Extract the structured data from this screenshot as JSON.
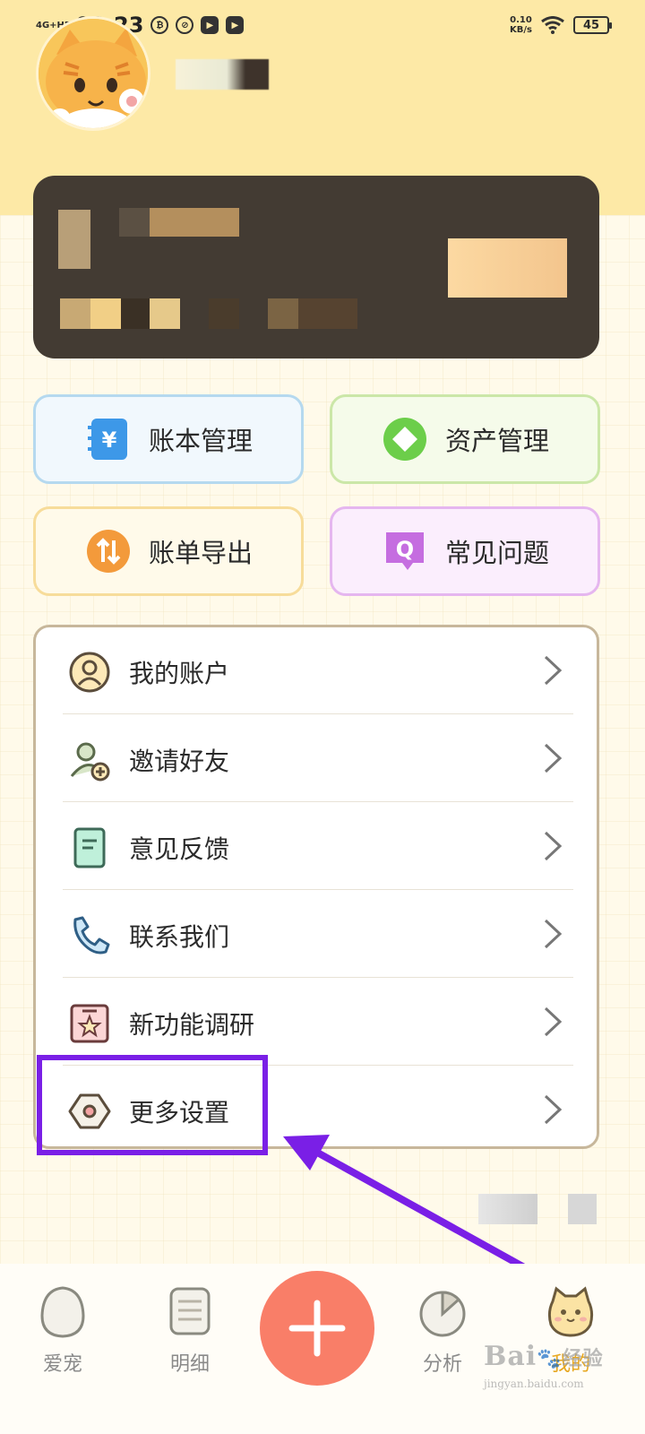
{
  "status_bar": {
    "network": "4G+HD",
    "time": "08:23",
    "speed_value": "0.10",
    "speed_unit": "KB/s",
    "battery": "45"
  },
  "quick_actions": [
    {
      "label": "账本管理",
      "icon": "ledger-icon",
      "icon_glyph": "¥",
      "border": "#b5d9ef",
      "bg": "#f1f8fd",
      "icon_color": "#3d98e8"
    },
    {
      "label": "资产管理",
      "icon": "assets-icon",
      "icon_glyph": "◆",
      "border": "#cbe7a8",
      "bg": "#f5fbea",
      "icon_color": "#6cce4a"
    },
    {
      "label": "账单导出",
      "icon": "export-icon",
      "icon_glyph": "⇅",
      "border": "#f7dc9a",
      "bg": "#fffaea",
      "icon_color": "#f39a3b"
    },
    {
      "label": "常见问题",
      "icon": "faq-icon",
      "icon_glyph": "Q",
      "border": "#e5b6ef",
      "bg": "#fbeefd",
      "icon_color": "#c56de0"
    }
  ],
  "menu": [
    {
      "label": "我的账户",
      "icon": "user-icon"
    },
    {
      "label": "邀请好友",
      "icon": "invite-friend-icon"
    },
    {
      "label": "意见反馈",
      "icon": "feedback-icon"
    },
    {
      "label": "联系我们",
      "icon": "phone-icon"
    },
    {
      "label": "新功能调研",
      "icon": "survey-icon"
    },
    {
      "label": "更多设置",
      "icon": "settings-icon"
    }
  ],
  "bottom_nav": [
    {
      "label": "爱宠",
      "icon": "egg-icon"
    },
    {
      "label": "明细",
      "icon": "details-icon"
    },
    {
      "label": "分析",
      "icon": "analysis-icon"
    },
    {
      "label": "我的",
      "icon": "cat-face-icon"
    }
  ],
  "watermark": {
    "brand": "Bai",
    "brand2": "经验",
    "url": "jingyan.baidu.com"
  },
  "colors": {
    "accent": "#f97e68",
    "header": "#fde9a6",
    "highlight": "#7a1fe6",
    "active_tab": "#e7a71f"
  }
}
